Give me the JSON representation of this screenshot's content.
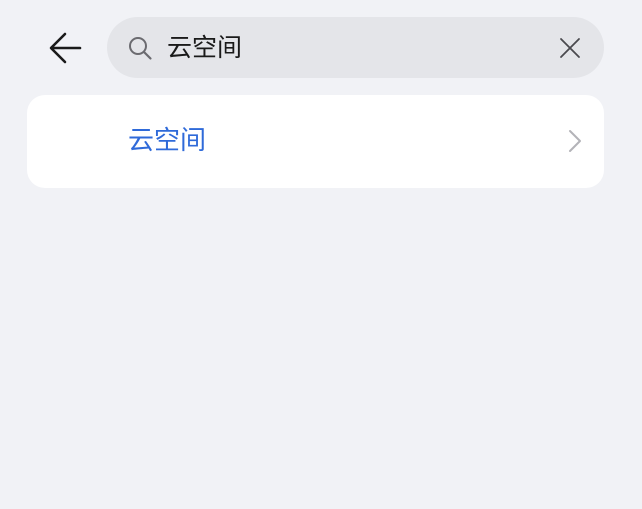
{
  "search": {
    "value": "云空间",
    "back_icon": "back-arrow-icon",
    "search_icon": "search-icon",
    "clear_icon": "close-icon"
  },
  "results": [
    {
      "label": "云空间",
      "icon": "chevron-right-icon"
    }
  ],
  "colors": {
    "background": "#f1f2f6",
    "search_box": "#e4e5e9",
    "card": "#ffffff",
    "result_text": "#2f6ad9"
  }
}
